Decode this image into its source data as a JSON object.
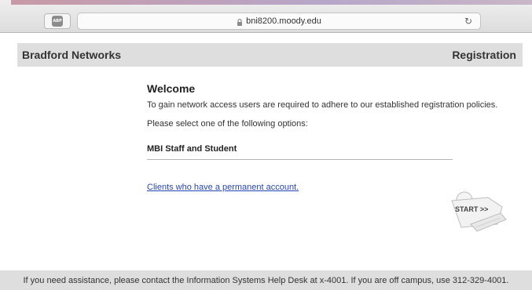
{
  "browser": {
    "url": "bni8200.moody.edu",
    "adblock_badge": "ABP",
    "icons": [
      "adblock-icon",
      "lock-icon",
      "reload-icon"
    ]
  },
  "header": {
    "brand": "Bradford Networks",
    "section": "Registration"
  },
  "main": {
    "heading": "Welcome",
    "intro": "To gain network access users are required to adhere to our established registration policies.",
    "prompt": "Please select one of the following options:",
    "option_label": "MBI Staff and Student",
    "link_text": "Clients who have a permanent account.",
    "start_label": "START >>"
  },
  "footer": {
    "text": "If you need assistance, please contact the Information Systems Help Desk at x-4001. If you are off campus, use 312-329-4001."
  },
  "colors": {
    "link": "#2645b8",
    "header_bg": "#dedede"
  }
}
